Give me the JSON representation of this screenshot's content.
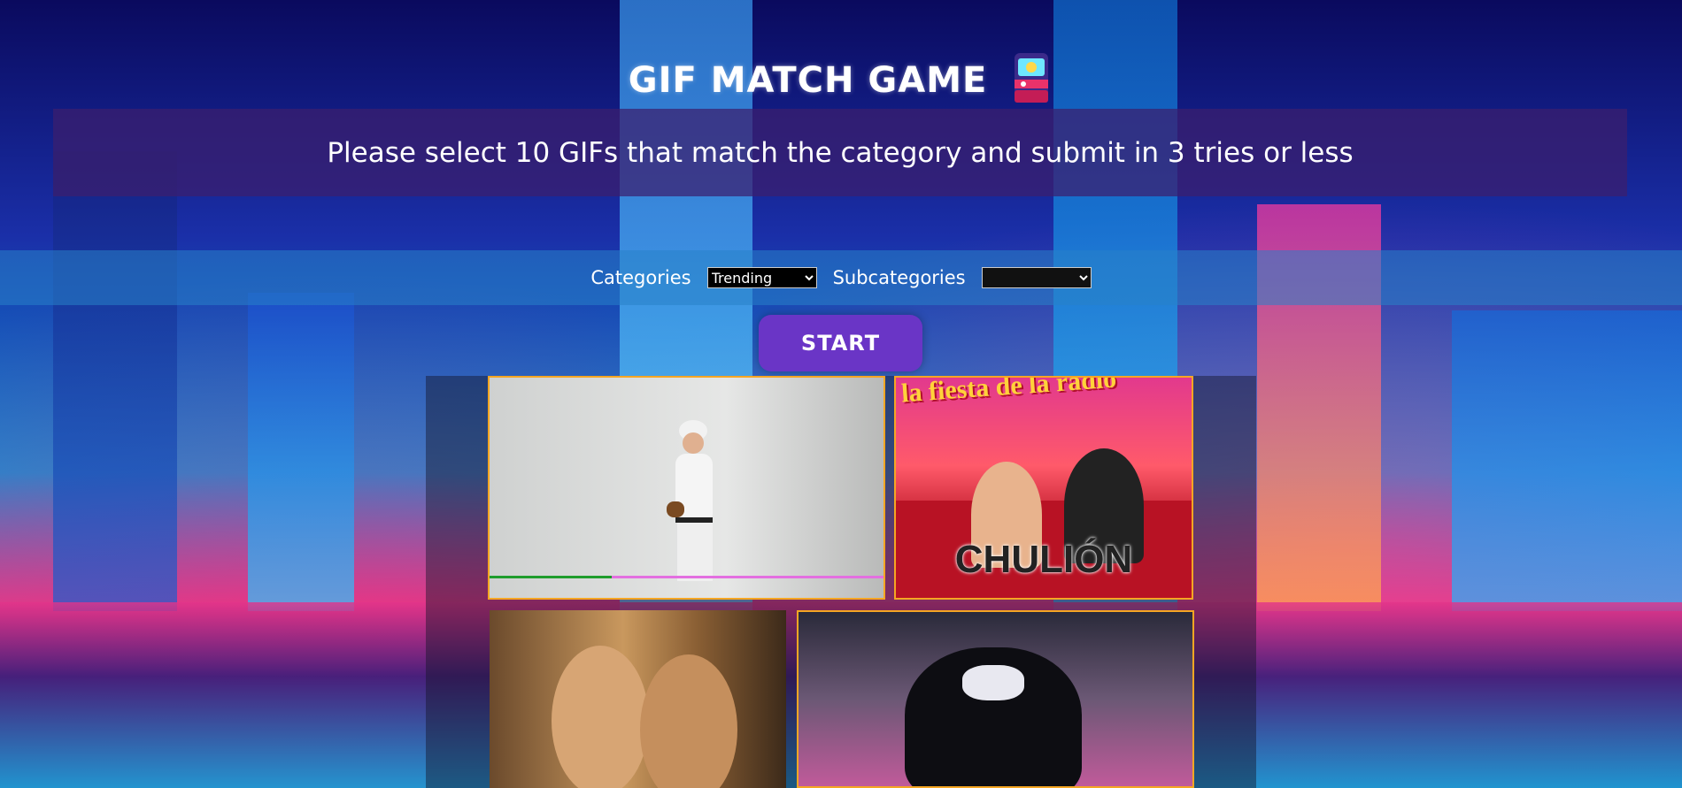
{
  "header": {
    "title": "GIF MATCH GAME",
    "arcade_emoji_name": "arcade-machine-icon"
  },
  "banner": {
    "instruction": "Please select 10 GIFs that match the category and submit in 3 tries or less"
  },
  "controls": {
    "categories_label": "Categories",
    "categories_selected": "Trending",
    "subcategories_label": "Subcategories",
    "subcategories_selected": ""
  },
  "start_button": {
    "label": "START"
  },
  "gifs": [
    {
      "caption": "",
      "progress": 0.31
    },
    {
      "caption": "CHULIÓN",
      "logo": "la fiesta de la radio"
    },
    {
      "caption": ""
    },
    {
      "caption": ""
    }
  ],
  "colors": {
    "accent_purple": "#6a35c6",
    "gif_border": "#f5a623",
    "banner_bg": "#3c1e6e"
  }
}
